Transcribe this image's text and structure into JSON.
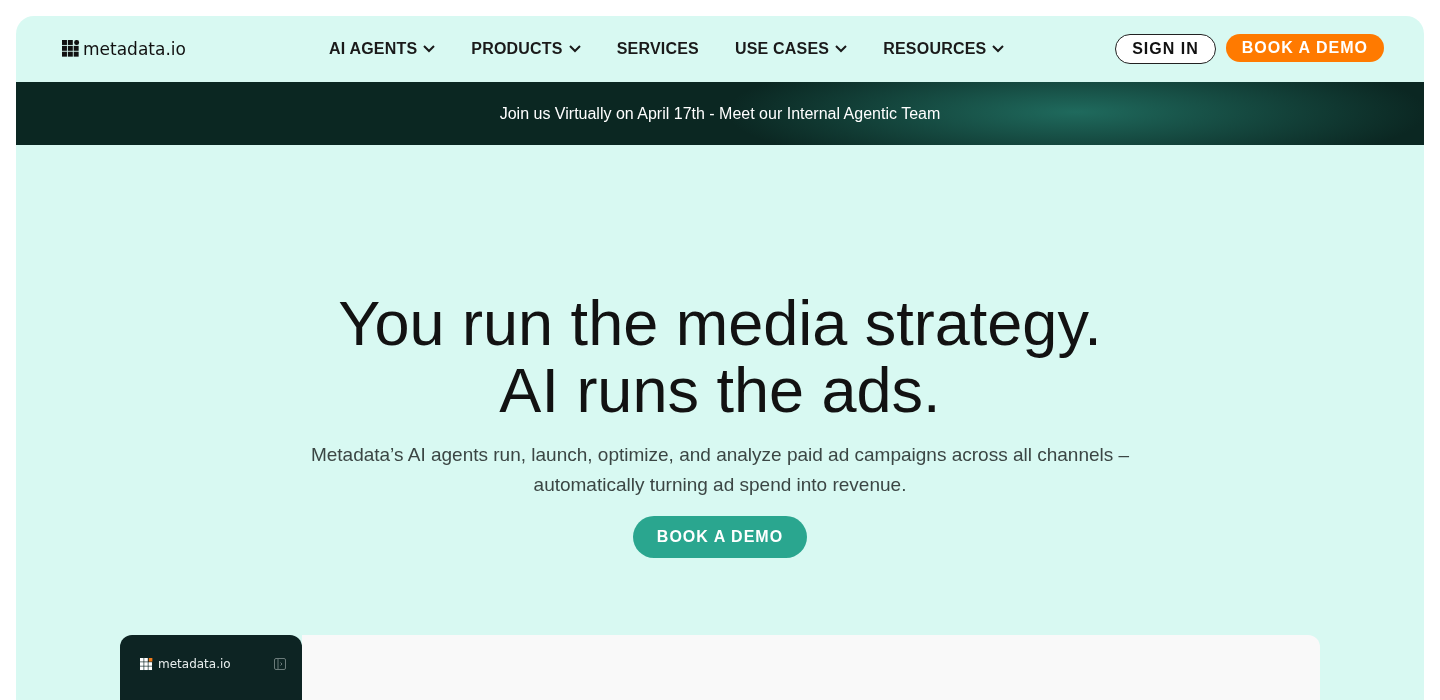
{
  "header": {
    "logo": "metadata.io",
    "nav": [
      {
        "label": "AI AGENTS",
        "kind": "dropdown"
      },
      {
        "label": "PRODUCTS",
        "kind": "dropdown"
      },
      {
        "label": "SERVICES",
        "kind": "link"
      },
      {
        "label": "USE CASES",
        "kind": "dropdown"
      },
      {
        "label": "RESOURCES",
        "kind": "dropdown"
      }
    ],
    "sign_in": "SIGN IN",
    "book_demo": "BOOK A DEMO"
  },
  "banner": {
    "text": "Join us Virtually on April 17th - Meet our Internal Agentic Team"
  },
  "hero": {
    "headline_lines": [
      "You run the media strategy.",
      "AI runs the ads."
    ],
    "subtitle": "Metadata’s AI agents run, launch, optimize, and analyze paid ad campaigns across all channels – automatically turning ad spend into revenue.",
    "cta": "BOOK A DEMO"
  },
  "app_preview": {
    "sidebar_logo": "metadata.io"
  }
}
